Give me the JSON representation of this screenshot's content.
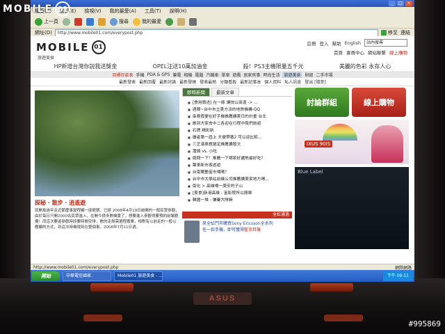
{
  "overlay": {
    "brand": "MOBILE",
    "emblem": "01",
    "photo_id": "#995869"
  },
  "browser": {
    "menu": [
      "檔案(F)",
      "編輯(E)",
      "檢視(V)",
      "我的最愛(A)",
      "工具(T)",
      "說明(H)"
    ],
    "toolbar": {
      "back": "上一頁",
      "search": "搜尋",
      "favorites": "我的最愛"
    },
    "address_label": "網址(D)",
    "address": "http://www.mobile01.com/everypost.php",
    "go": "移至",
    "links": "連結"
  },
  "site": {
    "logo_text": "MOBILE",
    "logo_emblem": "01",
    "subtitle": "旅遊美食",
    "top_links": [
      "註冊",
      "登入",
      "幫助",
      "English"
    ],
    "search_placeholder": "站內搜尋",
    "top_links2": [
      "首頁",
      "會員中心",
      "網站聯繫",
      "線上購物"
    ],
    "promos": [
      "HP新增台灣你說我送獎金",
      "OPEL汪送10萬加油金",
      "殺！PS3主機限量五千元",
      "美麗的色彩 永存人心"
    ],
    "nav": [
      "目標存款表",
      "手機",
      "PDA & GPS",
      "筆電",
      "相機",
      "電腦",
      "汽機車",
      "單車",
      "遊戲",
      "居家房事",
      "時尚生活",
      "旅遊美食",
      "財經",
      "二手市場"
    ],
    "nav_active": "旅遊美食",
    "nav_highlight": "目標存款表",
    "sub_nav": [
      "最新發表",
      "最新回覆",
      "最新討論",
      "最新發燒",
      "發表最熱",
      "分類看板",
      "最新記事本",
      "最新記事本",
      "個人資料",
      "私人訊息",
      "登出 [隨意]"
    ]
  },
  "feature": {
    "title": "探秘 · 散步 · 逍遙遊",
    "text": "就開島過年走近節慶事變程顯一座館朝，已經 2008年4月19日啟開的一般民眾參觀，由於每日只開2000名民眾進入，在開今擠多數機實了，想要進入參觀得要預約前聚觀費！而這次要遊參觀時段要時間安排，數的走周需選程應費，相對有以前走的一般以應顯的方式，到這次時機現到在整個事，2008年7月11日週。"
  },
  "tabs": {
    "tab1": "即時新聞",
    "tab2": "最新文章"
  },
  "topics": [
    "[食用簡述] 在一條 讓快公商道 -> ...",
    "週間~台中市立美方派的地質機構-QQ",
    "串寒假便在好手機推薦擴美日的計畫 台北",
    "誰到大家去中二各迎在行程中我們旅遊",
    "石牌 精彩新",
    "讀者第一屆上 大便帶著2 可以迎比較...",
    "三芝港車應選定推薦擴發文",
    "潛調 vs. 小吃",
    "請問一下！推薦一下哪家好處熱最好吃？",
    "葉車新市客遊遊",
    "台南驚艷富市場嗎？",
    "台中市大學站前幾公司推薦擴美家地方喝...",
    "南化 > 高雄場一美安的子山",
    "[美食]新港高雄 - 富影院所以簡單",
    "韓國一堆 - 嫌棄大隊嘛"
  ],
  "ad": {
    "header": "全虹通過",
    "line1": "來全虹門市購買Sony Ericsson全系列",
    "line2": "任一款手機，即可獲得",
    "line2_red": "藍芽耳機"
  },
  "right": {
    "forum_button": "討論群組",
    "shop_button": "線上購物",
    "promo_tag": "IXUS 90IS",
    "dark_ad_title": "Blue Label"
  },
  "status": {
    "url": "http://www.mobile01.com/everypost.php",
    "zone": "網際網路"
  },
  "taskbar": {
    "start": "開始",
    "items": [
      "中華電信國家.",
      "Mobile01 旅遊美食 - ..."
    ],
    "tray": "下午 09:11"
  },
  "laptop": {
    "brand": "ASUS"
  }
}
